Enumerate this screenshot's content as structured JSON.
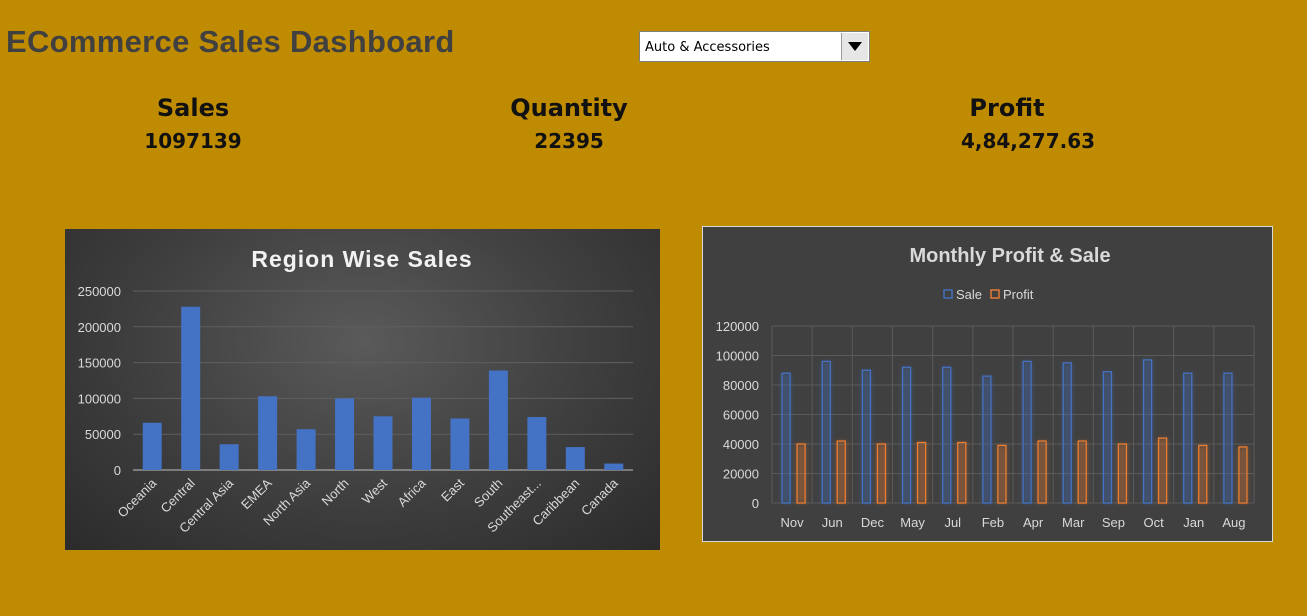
{
  "header": {
    "title": "ECommerce Sales Dashboard"
  },
  "filter": {
    "selected": "Auto & Accessories",
    "arrow_icon": "triangle-down"
  },
  "kpis": {
    "sales": {
      "label": "Sales",
      "value": "1097139"
    },
    "quantity": {
      "label": "Quantity",
      "value": "22395"
    },
    "profit": {
      "label": "Profit",
      "value": "4,84,277.63"
    }
  },
  "colors": {
    "background": "#bf8b00",
    "sale_bar": "#4472c4",
    "profit_bar": "#ed7d31"
  },
  "chart_data": [
    {
      "type": "bar",
      "title": "Region Wise Sales",
      "categories": [
        "Oceania",
        "Central",
        "Central Asia",
        "EMEA",
        "North Asia",
        "North",
        "West",
        "Africa",
        "East",
        "South",
        "Southeast...",
        "Caribbean",
        "Canada"
      ],
      "values": [
        66000,
        228000,
        36000,
        103000,
        57000,
        100000,
        75000,
        101000,
        72000,
        139000,
        74000,
        32000,
        9000
      ],
      "ylim": [
        0,
        250000
      ],
      "yticks": [
        "0",
        "50000",
        "100000",
        "150000",
        "200000",
        "250000"
      ],
      "grid": true,
      "legend": "none"
    },
    {
      "type": "bar",
      "title": "Monthly Profit & Sale",
      "categories": [
        "Nov",
        "Jun",
        "Dec",
        "May",
        "Jul",
        "Feb",
        "Apr",
        "Mar",
        "Sep",
        "Oct",
        "Jan",
        "Aug"
      ],
      "series": [
        {
          "name": "Sale",
          "values": [
            88000,
            96000,
            90000,
            92000,
            92000,
            86000,
            96000,
            95000,
            89000,
            97000,
            88000,
            88000
          ]
        },
        {
          "name": "Profit",
          "values": [
            40000,
            42000,
            40000,
            41000,
            41000,
            39000,
            42000,
            42000,
            40000,
            44000,
            39000,
            38000
          ]
        }
      ],
      "ylim": [
        0,
        120000
      ],
      "yticks": [
        "0",
        "20000",
        "40000",
        "60000",
        "80000",
        "100000",
        "120000"
      ],
      "grid": true,
      "legend": "top"
    }
  ]
}
